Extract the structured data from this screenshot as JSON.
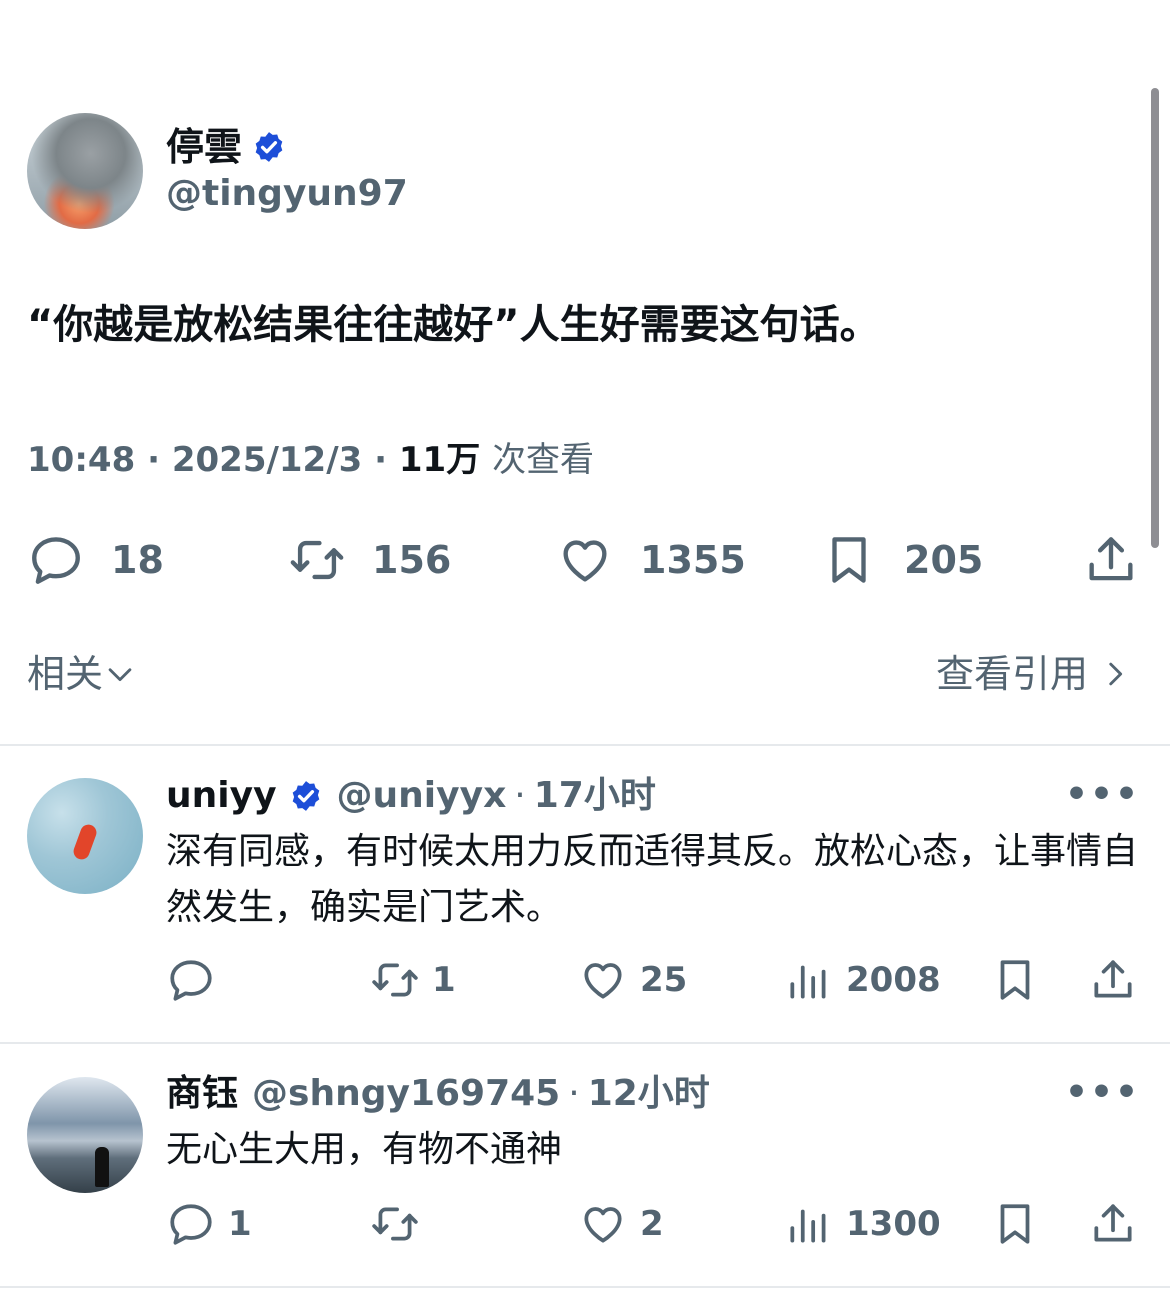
{
  "tweet": {
    "display_name": "停雲",
    "handle": "@tingyun97",
    "text": "“你越是放松结果往往越好”人生好需要这句话。",
    "time": "10:48",
    "date": "2025/12/3",
    "views": "11万",
    "views_label": "次查看",
    "reply_count": "18",
    "retweet_count": "156",
    "like_count": "1355",
    "bookmark_count": "205"
  },
  "related_label": "相关",
  "quotes_label": "查看引用",
  "replies": [
    {
      "display_name": "uniyy",
      "handle": "@uniyyx",
      "time": "17小时",
      "text": "深有同感，有时候太用力反而适得其反。放松心态，让事情自然发生，确实是门艺术。",
      "reply_count": "",
      "retweet_count": "1",
      "like_count": "25",
      "view_count": "2008"
    },
    {
      "display_name": "商钰",
      "handle": "@shngy169745",
      "time": "12小时",
      "text": "无心生大用，有物不通神",
      "reply_count": "1",
      "retweet_count": "",
      "like_count": "2",
      "view_count": "1300"
    }
  ],
  "separator": "·",
  "more_label": "•••",
  "colors": {
    "verified": "#1d4ed8",
    "muted": "#536471",
    "text": "#0f1419"
  },
  "icons": [
    "verified-badge-icon",
    "reply-icon",
    "retweet-icon",
    "like-icon",
    "bookmark-icon",
    "share-icon",
    "views-icon",
    "chevron-down-icon",
    "chevron-right-icon",
    "more-icon"
  ]
}
